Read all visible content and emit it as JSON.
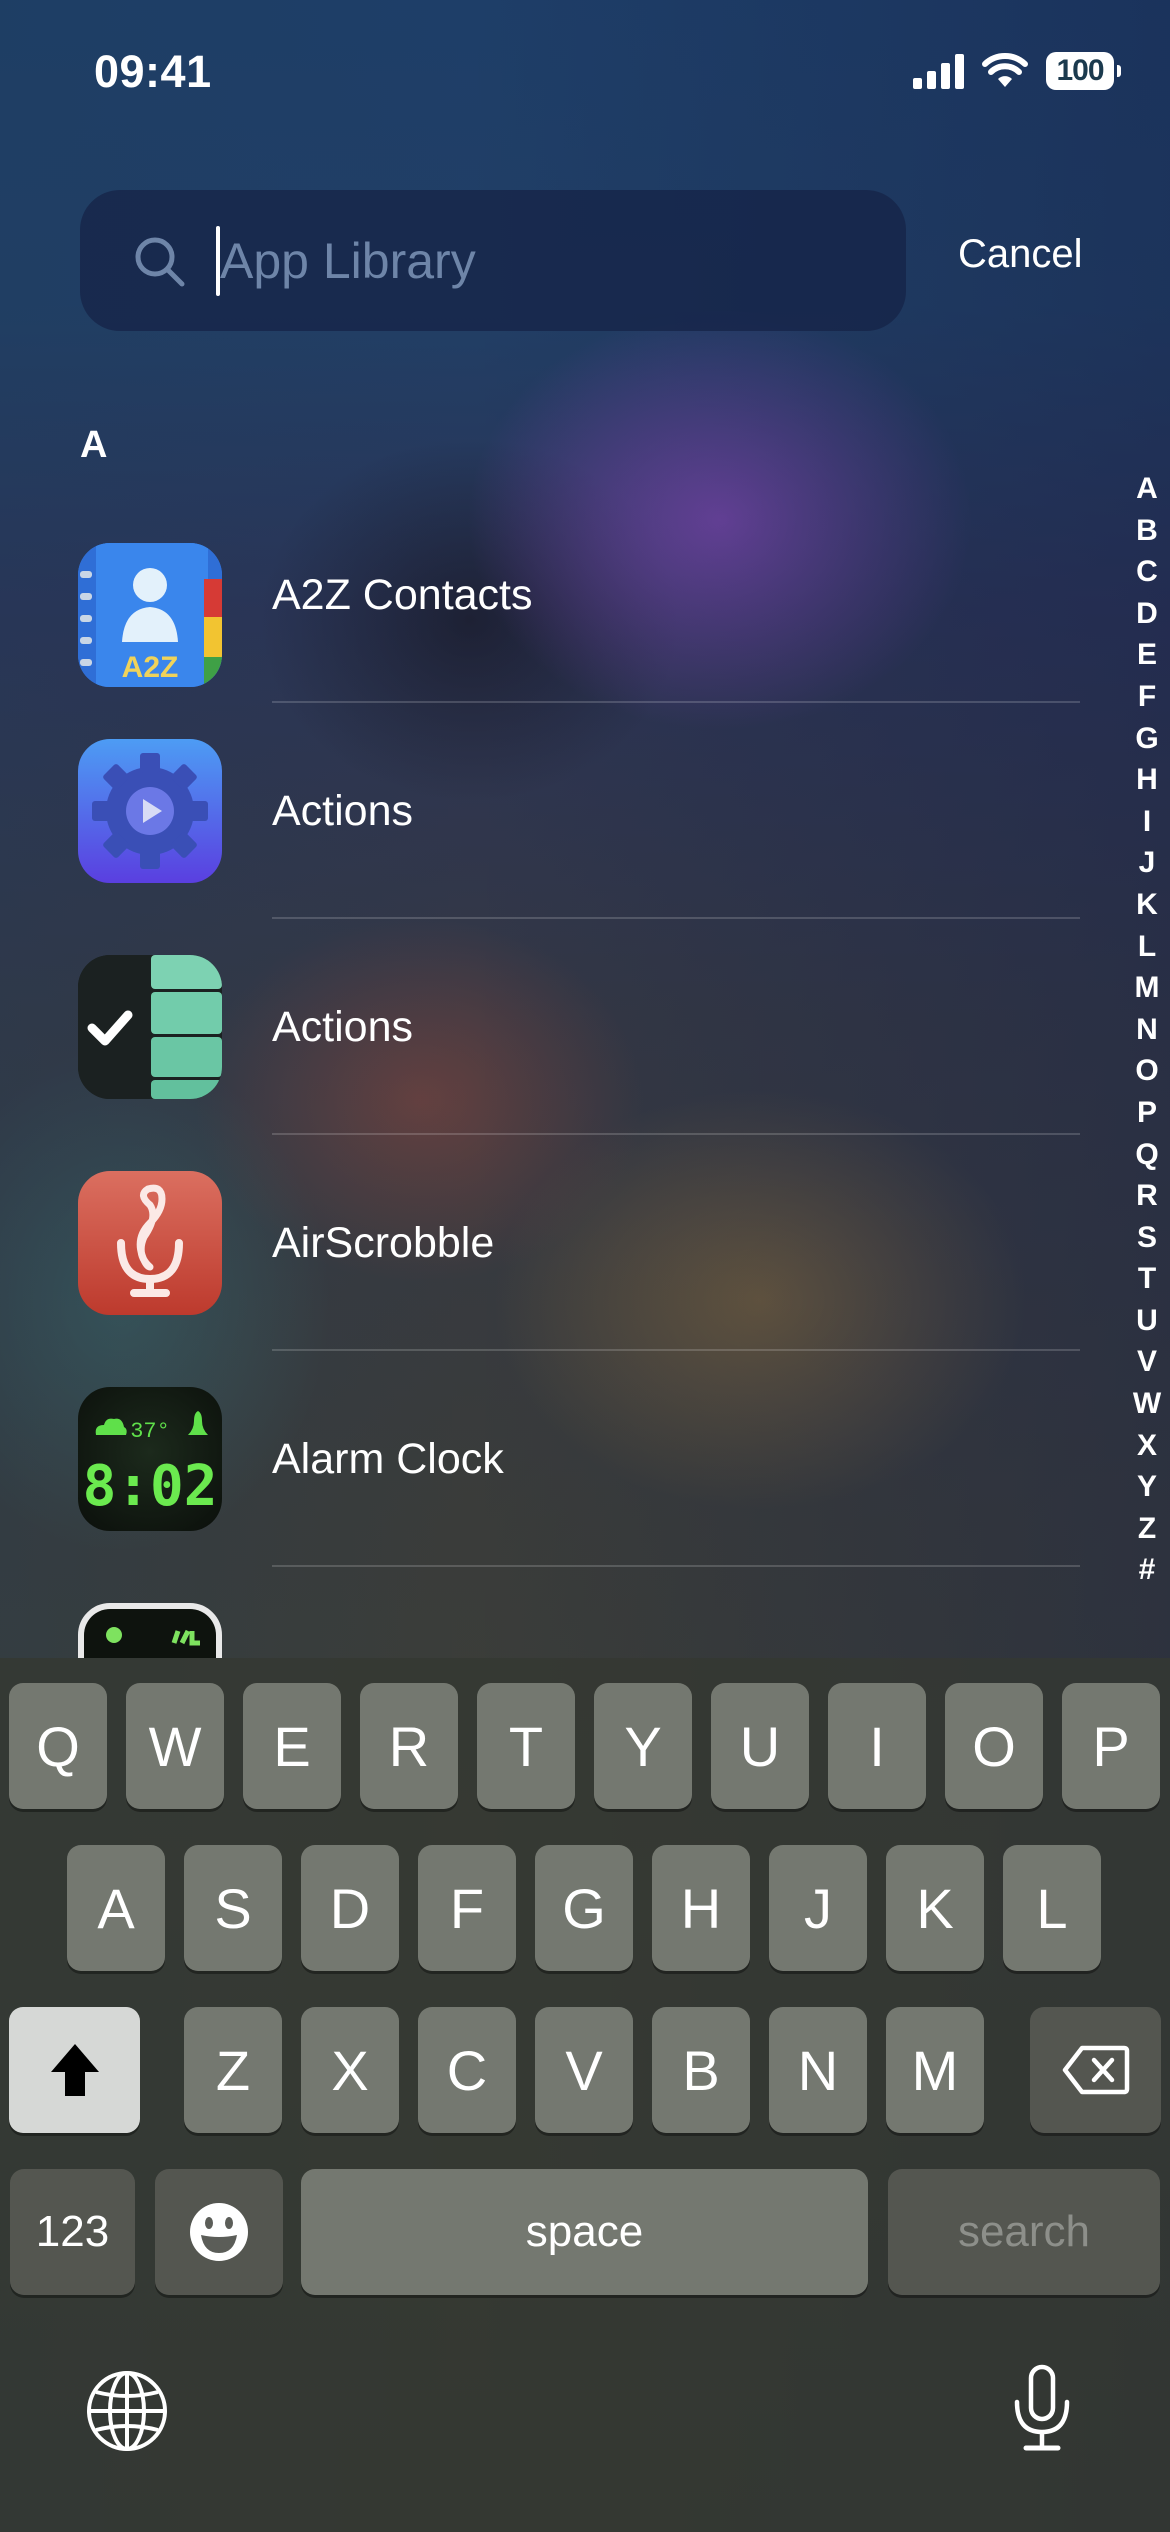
{
  "status_bar": {
    "time": "09:41",
    "battery": "100",
    "icons": [
      "cellular-signal-icon",
      "wifi-icon",
      "battery-icon"
    ]
  },
  "search": {
    "placeholder": "App Library",
    "value": "",
    "cancel_label": "Cancel",
    "icon": "search-icon"
  },
  "section": {
    "header": "A"
  },
  "apps": [
    {
      "name": "A2Z Contacts",
      "icon": "a2z-contacts-icon"
    },
    {
      "name": "Actions",
      "icon": "actions-gear-icon"
    },
    {
      "name": "Actions",
      "icon": "actions-checklist-icon"
    },
    {
      "name": "AirScrobble",
      "icon": "airscrobble-mic-icon"
    },
    {
      "name": "Alarm Clock",
      "icon": "alarm-clock-icon"
    },
    {
      "name": "",
      "icon": "alarm-clock-hd-icon"
    }
  ],
  "alarm_icon": {
    "temp": "37°",
    "time": "8:02"
  },
  "a2z_icon_text": "A2Z",
  "index": [
    "A",
    "B",
    "C",
    "D",
    "E",
    "F",
    "G",
    "H",
    "I",
    "J",
    "K",
    "L",
    "M",
    "N",
    "O",
    "P",
    "Q",
    "R",
    "S",
    "T",
    "U",
    "V",
    "W",
    "X",
    "Y",
    "Z",
    "#"
  ],
  "keyboard": {
    "row1": [
      "Q",
      "W",
      "E",
      "R",
      "T",
      "Y",
      "U",
      "I",
      "O",
      "P"
    ],
    "row2": [
      "A",
      "S",
      "D",
      "F",
      "G",
      "H",
      "J",
      "K",
      "L"
    ],
    "row3": [
      "Z",
      "X",
      "C",
      "V",
      "B",
      "N",
      "M"
    ],
    "numbers_label": "123",
    "space_label": "space",
    "search_label": "search",
    "icons": [
      "shift-icon",
      "delete-icon",
      "emoji-icon",
      "globe-icon",
      "microphone-icon"
    ]
  }
}
